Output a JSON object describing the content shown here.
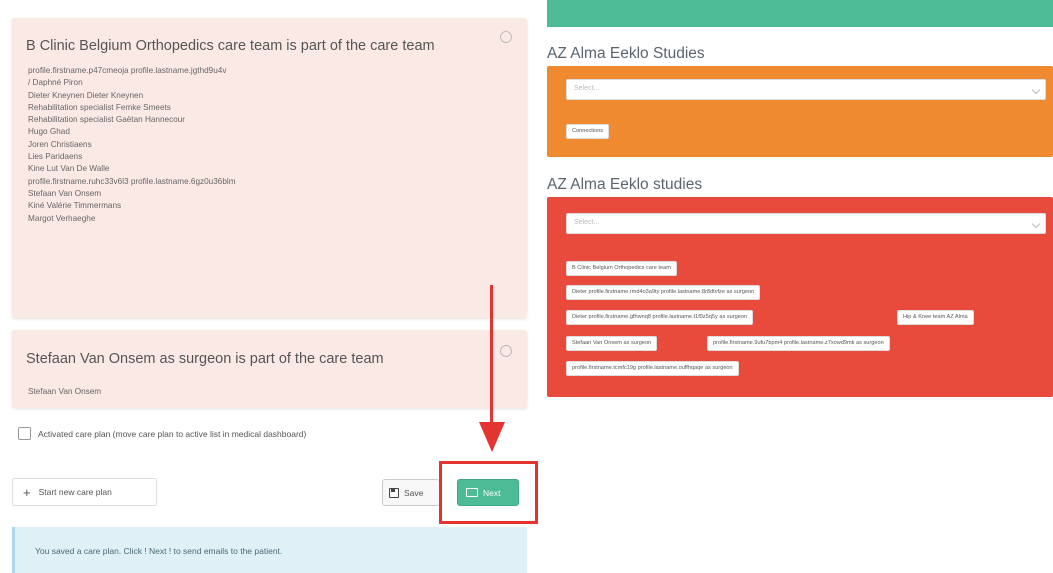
{
  "care_teams": [
    {
      "title": "B Clinic Belgium Orthopedics care team is part of the care team",
      "members": [
        "profile.firstname.p47cmeoja profile.lastname.jgthd9u4v",
        "/ Daphné Piron",
        "Dieter Kneynen Dieter Kneynen",
        "Rehabilitation specialist Femke Smeets",
        "Rehabilitation specialist Gaëtan Hannecour",
        "Hugo Ghad",
        "Joren Christiaens",
        "Lies Paridaens",
        "Kine Lut Van De Walle",
        "profile.firstname.ruhc33v6l3 profile.lastname.6gz0u36blm",
        "Stefaan Van Onsem",
        "Kiné Valérie Timmermans",
        "Margot Verhaeghe"
      ]
    },
    {
      "title": "Stefaan Van Onsem as surgeon is part of the care team",
      "members": [
        "Stefaan Van Onsem"
      ]
    }
  ],
  "activated_checkbox": {
    "label": "Activated care plan (move care plan to active list in medical dashboard)",
    "checked": false
  },
  "buttons": {
    "start_new": "Start new care plan",
    "save": "Save",
    "next": "Next"
  },
  "info_message": "You saved a care plan. Click ! Next ! to send emails to the patient.",
  "studies": [
    {
      "title": "AZ Alma Eeklo Studies",
      "color": "#f08a30",
      "select_placeholder": "Select...",
      "tags": [
        "Connections"
      ]
    },
    {
      "title": "AZ Alma Eeklo studies",
      "color": "#e84b3c",
      "select_placeholder": "Select...",
      "tags": [
        "B Clinic Belgium Orthopedics care team",
        "Dieter profile.firstname.rmd4o3a9ty profile.lastname.8r8dtvfze as surgeon",
        "Dieter profile.firstname.gfhwnq8 profile.lastname.t1f9z5q5y as surgeon",
        "Hip & Knee team AZ Alma",
        "Stefaan Van Onsem as surgeon",
        "profile.firstname.9ufu7bpm4 profile.lastname.z7xowd9mk as surgeon",
        "profile.firstname.tcmfc19g profile.lastname.ouffhqaqe as surgeon"
      ]
    }
  ],
  "colors": {
    "accent_teal": "#4dbb96",
    "highlight_red": "#e3342f",
    "card_bg": "#fbe9e6",
    "info_bg": "#dff0f7"
  }
}
